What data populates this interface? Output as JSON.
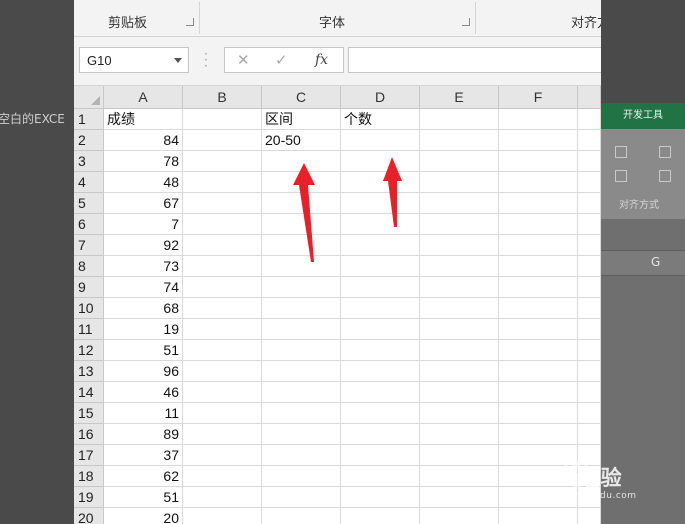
{
  "background": {
    "left_partial_text": "空白的EXCE",
    "right_panel": {
      "tab_label": "开发工具",
      "group_label": "对齐方式",
      "column_letter": "G"
    }
  },
  "ribbon": {
    "groups": [
      {
        "label": "剪贴板"
      },
      {
        "label": "字体"
      },
      {
        "label": "对齐方"
      }
    ]
  },
  "formula_bar": {
    "name_box": "G10",
    "cancel_glyph": "✕",
    "enter_glyph": "✓",
    "fx_label": "fx",
    "formula": ""
  },
  "sheet": {
    "columns": [
      "A",
      "B",
      "C",
      "D",
      "E",
      "F"
    ],
    "rows": [
      {
        "num": "1",
        "A": "成绩",
        "C": "区间",
        "D": "个数"
      },
      {
        "num": "2",
        "A": "84",
        "C": "20-50"
      },
      {
        "num": "3",
        "A": "78"
      },
      {
        "num": "4",
        "A": "48"
      },
      {
        "num": "5",
        "A": "67"
      },
      {
        "num": "6",
        "A": "7"
      },
      {
        "num": "7",
        "A": "92"
      },
      {
        "num": "8",
        "A": "73"
      },
      {
        "num": "9",
        "A": "74"
      },
      {
        "num": "10",
        "A": "68"
      },
      {
        "num": "11",
        "A": "19"
      },
      {
        "num": "12",
        "A": "51"
      },
      {
        "num": "13",
        "A": "96"
      },
      {
        "num": "14",
        "A": "46"
      },
      {
        "num": "15",
        "A": "11"
      },
      {
        "num": "16",
        "A": "89"
      },
      {
        "num": "17",
        "A": "37"
      },
      {
        "num": "18",
        "A": "62"
      },
      {
        "num": "19",
        "A": "51"
      },
      {
        "num": "20",
        "A": "20"
      }
    ]
  },
  "annotation": {
    "arrow_color": "#e8202a"
  },
  "watermark": {
    "text": "Bai 经验",
    "sub": "jingyan.baidu.com"
  }
}
